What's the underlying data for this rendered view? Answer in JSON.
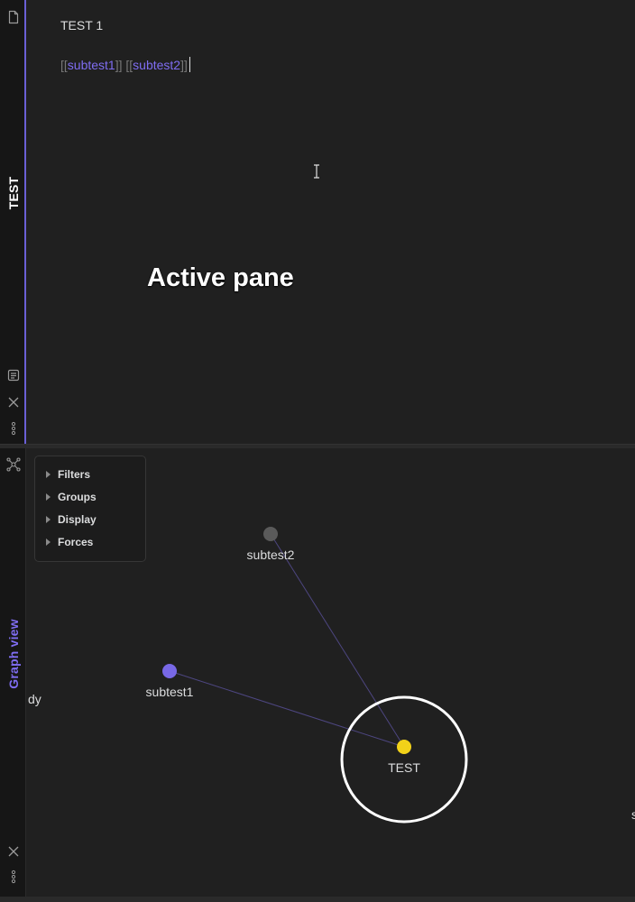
{
  "top_pane": {
    "tab_title": "TEST",
    "editor": {
      "title": "TEST 1",
      "links": [
        {
          "open": "[[",
          "text": "subtest1",
          "close": "]]"
        },
        {
          "open": "[[",
          "text": "subtest2",
          "close": "]]"
        }
      ]
    },
    "annotation": "Active pane",
    "icons": [
      "file-icon",
      "reading-view-icon",
      "close-icon",
      "more-options-icon"
    ]
  },
  "bottom_pane": {
    "tab_title": "Graph view",
    "controls": [
      "Filters",
      "Groups",
      "Display",
      "Forces"
    ],
    "graph": {
      "nodes": [
        {
          "label": "subtest2",
          "color": "#5a5a5a"
        },
        {
          "label": "subtest1",
          "color": "#7868e6"
        },
        {
          "label": "TEST",
          "color": "#f2d219",
          "highlighted": true
        }
      ],
      "edges": [
        {
          "from": "subtest2",
          "to": "TEST"
        },
        {
          "from": "subtest1",
          "to": "TEST"
        }
      ]
    },
    "edge_text_left": "dy",
    "edge_text_right": "s",
    "icons": [
      "graph-icon",
      "close-icon",
      "more-options-icon"
    ]
  },
  "colors": {
    "accent": "#7f6df2",
    "background": "#202020",
    "sidebar": "#161616",
    "edge": "#4d4680",
    "focus_ring": "#ffffff"
  }
}
